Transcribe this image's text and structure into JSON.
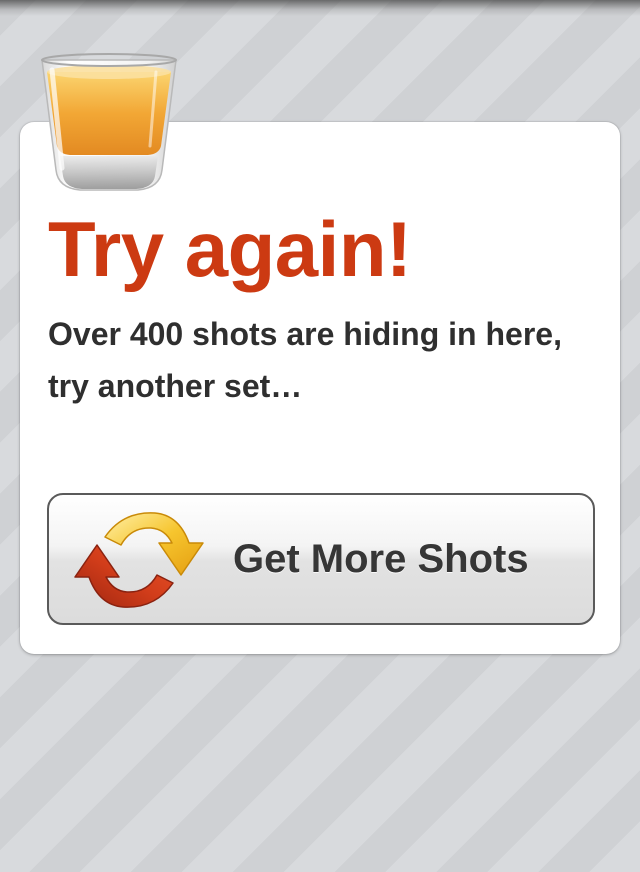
{
  "result": {
    "title": "Try again!",
    "message": "Over 400 shots are hiding in here, try another set…"
  },
  "button": {
    "label": "Get More Shots",
    "icon": "refresh-arrows-icon"
  },
  "decoration": {
    "icon": "shot-glass-icon"
  },
  "colors": {
    "title": "#cc3a12",
    "text": "#2f2f2f",
    "arrow_red": "#c8371a",
    "arrow_yellow": "#f3bc1c",
    "card": "#ffffff",
    "background": "#d3d5d8"
  }
}
